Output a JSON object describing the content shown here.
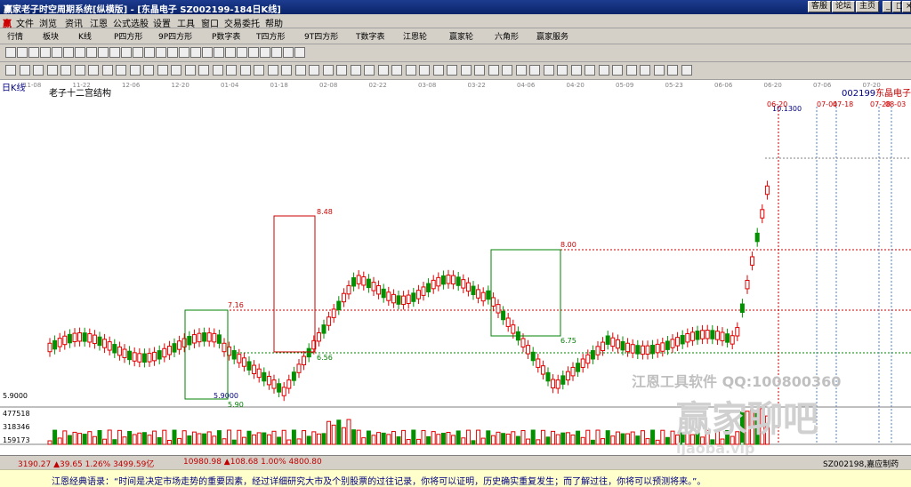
{
  "window": {
    "title": "赢家老子时空周期系统[纵横版] - [东晶电子  SZ002199-184日K线]",
    "top_buttons": [
      "客服",
      "论坛",
      "主页"
    ]
  },
  "menu": [
    "文件",
    "浏览",
    "资讯",
    "江恩",
    "公式选股",
    "设置",
    "工具",
    "窗口",
    "交易委托",
    "帮助"
  ],
  "toolbar1": [
    "行情",
    "板块",
    "K线",
    "P四方形",
    "9P四方形",
    "P数字表",
    "T四方形",
    "9T四方形",
    "T数字表",
    "江恩轮",
    "赢家轮",
    "六角形",
    "赢家服务"
  ],
  "chart": {
    "period_label": "日K线",
    "indicator_label": "老子十二宫结构",
    "stock_code": "002199",
    "stock_name": "东晶电子",
    "dates": [
      "11-08",
      "11-22",
      "12-06",
      "12-20",
      "01-04",
      "01-18",
      "02-08",
      "02-22",
      "03-08",
      "03-22",
      "04-06",
      "04-20",
      "05-09",
      "05-23",
      "06-06",
      "06-20",
      "07-06",
      "07-20",
      "08-03"
    ],
    "price_labels": [
      "10.1300",
      "8.48",
      "8.00",
      "7.16",
      "6.56",
      "5.9000",
      "5.90",
      "6.75",
      "5.9000"
    ],
    "future_labels": [
      "06-20",
      "07-04",
      "07-18",
      "07-28",
      "08-03"
    ],
    "volume_axis": [
      "477518",
      "318346",
      "159173"
    ],
    "watermark_line1": "江恩工具软件  QQ:100800360",
    "watermark_line2": "赢家聊吧",
    "watermark_line3": "ljaoba.vip",
    "colors": {
      "up": "#e00000",
      "down": "#009000",
      "box_red": "#cc0000",
      "box_green": "#008000"
    }
  },
  "chart_data": {
    "type": "candlestick",
    "title": "老子十二宫结构",
    "ylim": [
      5.5,
      10.5
    ],
    "y_ticks": [
      "5.9000"
    ],
    "volume_ticks": [
      "477518",
      "318346",
      "159173"
    ],
    "notes": "Daily K-line of SZ002199; red/green boxes mark structure zones 7.16–5.90, 8.48–6.56, 8.00–6.75; peak 10.13"
  },
  "status": {
    "index1": "3190.27 ▲39.65 1.26% 3499.59亿",
    "index2": "10980.98 ▲108.68 1.00% 4800.80",
    "stock": "SZ002198,嘉应制药"
  },
  "quote": "江恩经典语录：“时间是决定市场走势的重要因素，经过详细研究大市及个别股票的过往记录，你将可以证明，历史确实重复发生；而了解过往，你将可以预测将来。”。"
}
